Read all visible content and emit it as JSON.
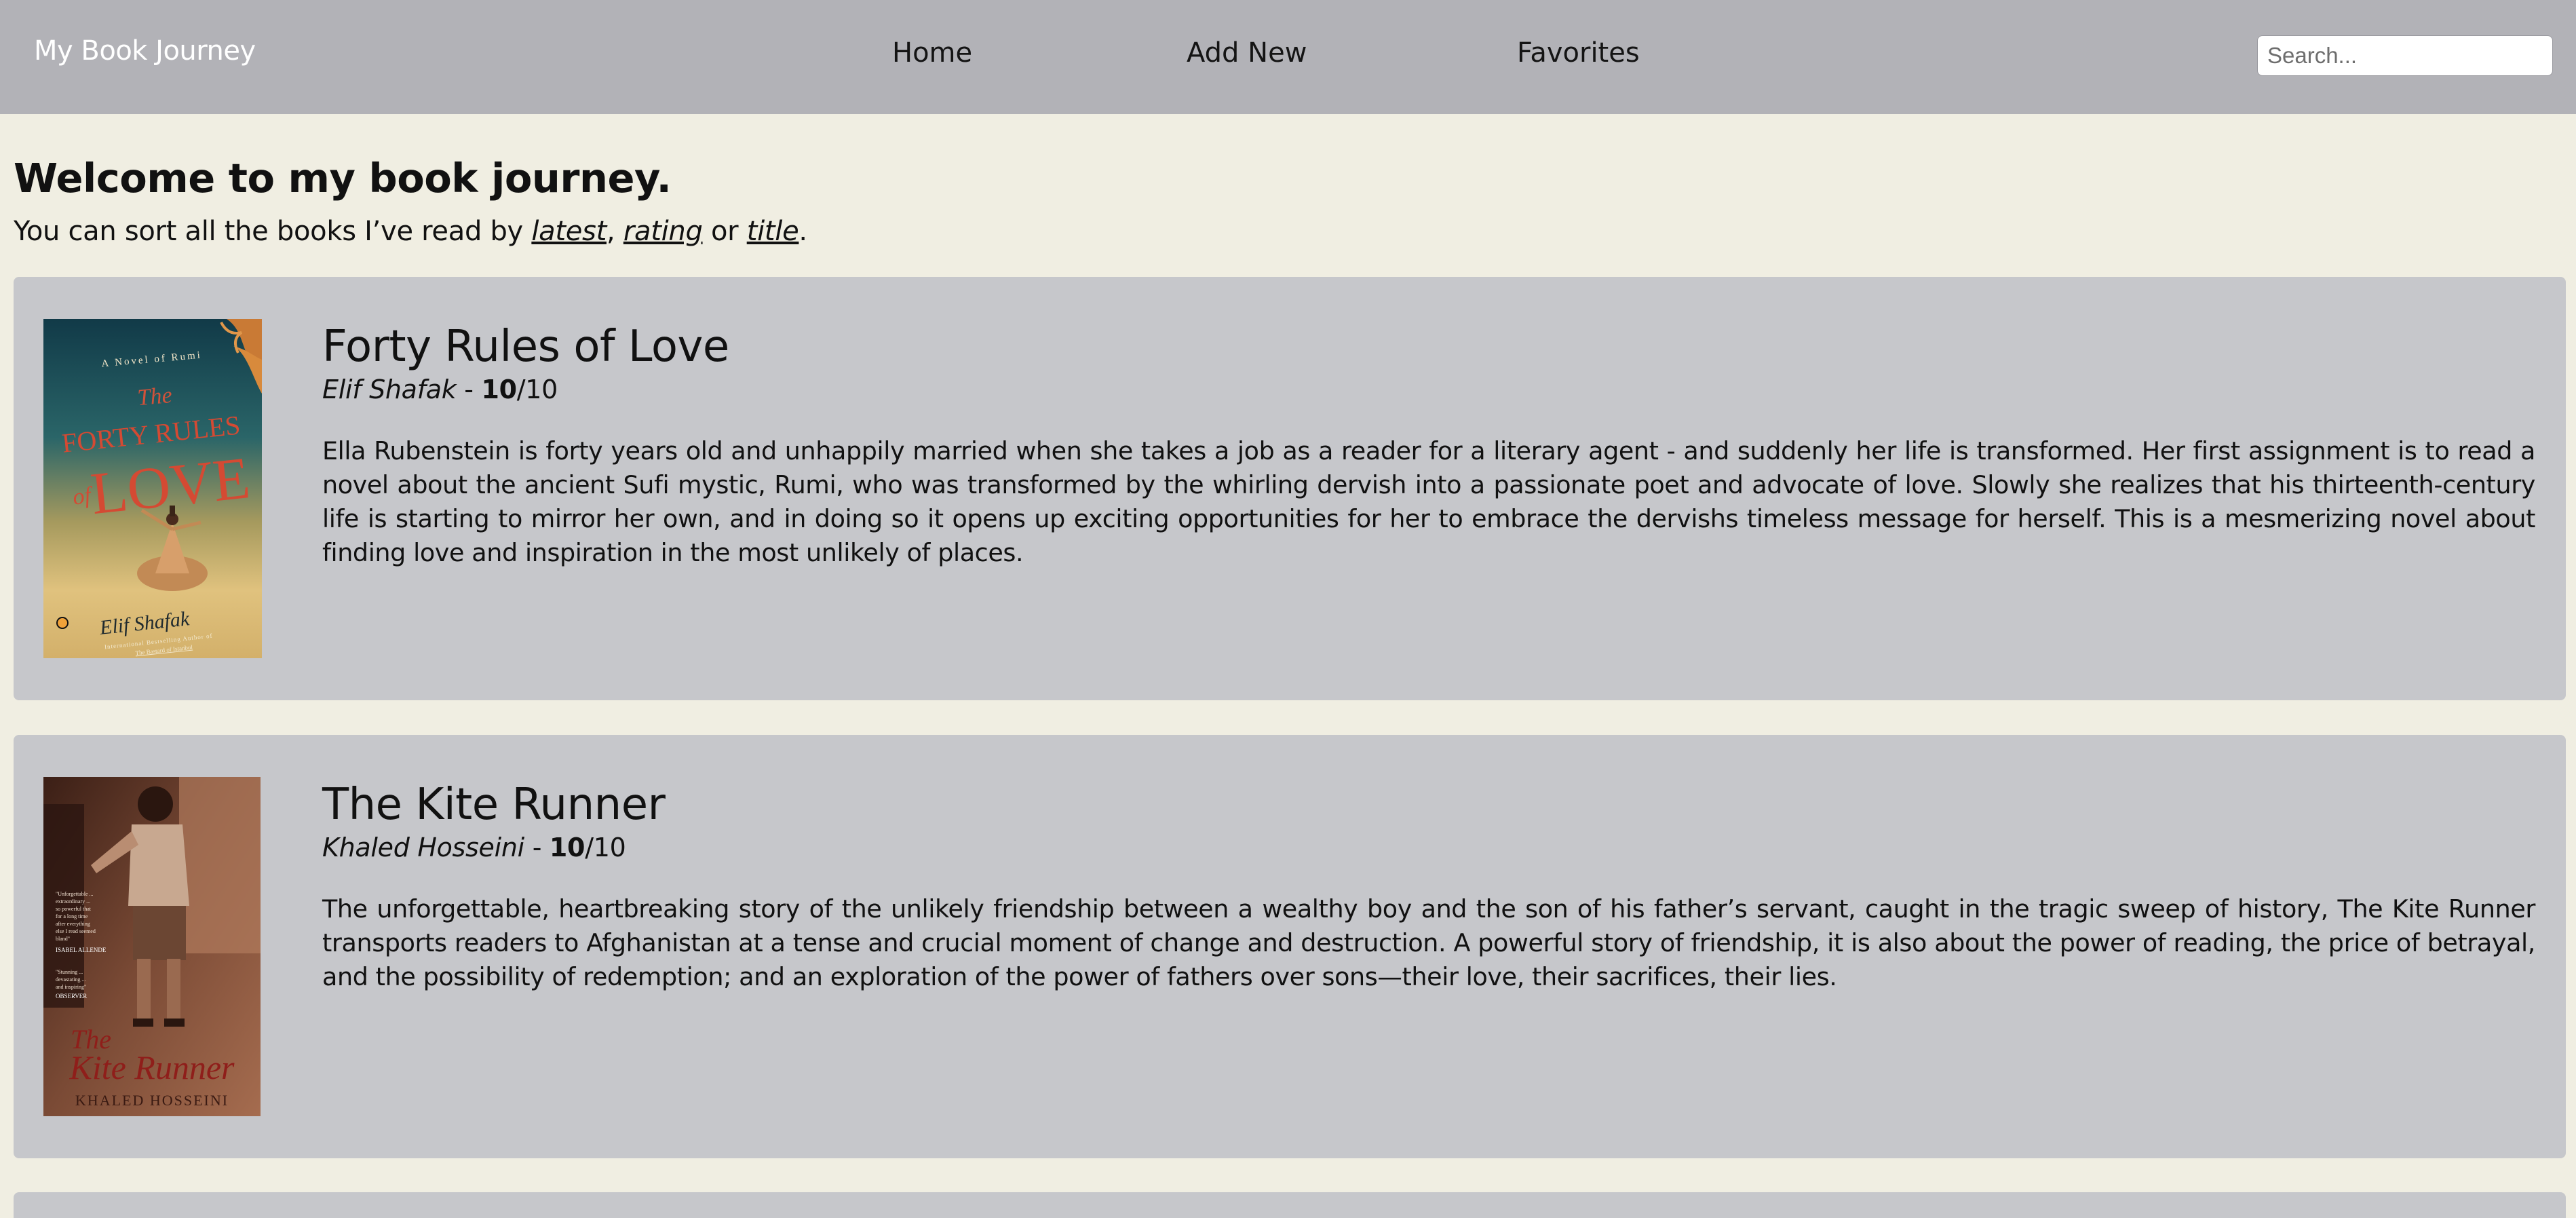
{
  "navbar": {
    "brand": "My Book Journey",
    "links": [
      "Home",
      "Add New",
      "Favorites"
    ],
    "search_placeholder": "Search..."
  },
  "intro": {
    "title": "Welcome to my book journey.",
    "sort_prefix": "You can sort all the books I’ve read by ",
    "sort_latest": "latest",
    "sort_sep1": ", ",
    "sort_rating": "rating",
    "sort_sep2": " or ",
    "sort_title": "title",
    "sort_suffix": "."
  },
  "books": [
    {
      "title": "Forty Rules of Love",
      "author": "Elif Shafak",
      "separator": " - ",
      "score": "10",
      "score_max": "/10",
      "description": "Ella Rubenstein is forty years old and unhappily married when she takes a job as a reader for a literary agent - and suddenly her life is transformed. Her first assignment is to read a novel about the ancient Sufi mystic, Rumi, who was transformed by the whirling dervish into a passionate poet and advocate of love. Slowly she realizes that his thirteenth-century life is starting to mirror her own, and in doing so it opens up exciting opportunities for her to embrace the dervishs timeless message for herself. This is a mesmerizing novel about finding love and inspiration in the most unlikely of places.",
      "cover": {
        "top_line": "A Novel of Rumi",
        "the": "The",
        "title_line1": "FORTY RULES",
        "of": "of",
        "title_line2": "LOVE",
        "author": "Elif Shafak",
        "tagline": "International Bestselling Author of",
        "tagline2": "The Bastard of Istanbul"
      }
    },
    {
      "title": "The Kite Runner",
      "author": "Khaled Hosseini",
      "separator": " - ",
      "score": "10",
      "score_max": "/10",
      "description": "The unforgettable, heartbreaking story of the unlikely friendship between a wealthy boy and the son of his father’s servant, caught in the tragic sweep of history, The Kite Runner transports readers to Afghanistan at a tense and crucial moment of change and destruction. A powerful story of friendship, it is also about the power of reading, the price of betrayal, and the possibility of redemption; and an exploration of the power of fathers over sons—their love, their sacrifices, their lies.",
      "cover": {
        "blurb1": "\"Unforgettable ... extraordinary ... so powerful that for a long time after everything else that I read seemed bland\"",
        "blurb1_by": "ISABEL ALLENDE",
        "blurb2": "\"Stunning ... devastating ... and inspiring\"",
        "blurb2_by": "OBSERVER",
        "title_line1": "The",
        "title_line2": "Kite Runner",
        "author": "KHALED HOSSEINI"
      }
    }
  ],
  "colors": {
    "navbar": "#b2b2b7",
    "page": "#f0eee2",
    "card": "#c6c7cb",
    "brand_text": "#ffffff"
  }
}
